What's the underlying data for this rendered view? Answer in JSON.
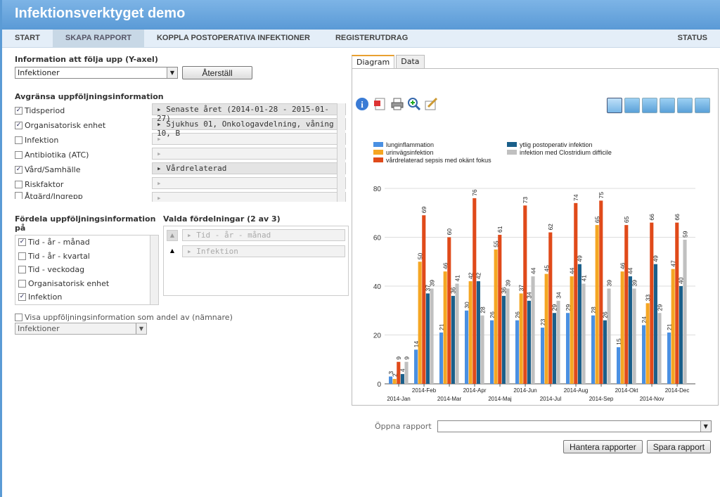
{
  "app": {
    "title": "Infektionsverktyget demo"
  },
  "nav": {
    "items": [
      "START",
      "SKAPA RAPPORT",
      "KOPPLA POSTOPERATIVA INFEKTIONER",
      "REGISTERUTDRAG"
    ],
    "status": "STATUS"
  },
  "yaxis": {
    "label": "Information att följa upp (Y-axel)",
    "value": "Infektioner",
    "reset": "Återställ"
  },
  "limit": {
    "label": "Avgränsa uppföljningsinformation",
    "items": [
      {
        "label": "Tidsperiod",
        "checked": true,
        "value": "Senaste året (2014-01-28 - 2015-01-27)"
      },
      {
        "label": "Organisatorisk enhet",
        "checked": true,
        "value": "Sjukhus 01, Onkologavdelning, våning 10, B"
      },
      {
        "label": "Infektion",
        "checked": false,
        "value": ""
      },
      {
        "label": "Antibiotika (ATC)",
        "checked": false,
        "value": ""
      },
      {
        "label": "Vård/Samhälle",
        "checked": true,
        "value": "Vårdrelaterad"
      },
      {
        "label": "Riskfaktor",
        "checked": false,
        "value": ""
      },
      {
        "label": "Åtgärd/Ingrepp",
        "checked": false,
        "value": ""
      }
    ]
  },
  "distribute": {
    "label": "Fördela uppföljningsinformation på",
    "items": [
      {
        "label": "Tid - år - månad",
        "checked": true
      },
      {
        "label": "Tid - år - kvartal",
        "checked": false
      },
      {
        "label": "Tid - veckodag",
        "checked": false
      },
      {
        "label": "Organisatorisk enhet",
        "checked": false
      },
      {
        "label": "Infektion",
        "checked": true
      }
    ]
  },
  "chosen": {
    "label": "Valda fördelningar (2 av 3)",
    "items": [
      "Tid - år - månad",
      "Infektion"
    ]
  },
  "share": {
    "label": "Visa uppföljningsinformation som andel av (nämnare)",
    "value": "Infektioner"
  },
  "tabs": [
    "Diagram",
    "Data"
  ],
  "report": {
    "open_label": "Öppna rapport",
    "manage": "Hantera rapporter",
    "save": "Spara rapport"
  },
  "colors": {
    "lung": "#4a90e2",
    "uri": "#f5a623",
    "sep": "#e04a1a",
    "post": "#1a5f8a",
    "clos": "#c0c0c0"
  },
  "chart_data": {
    "type": "bar",
    "categories": [
      "2014-Jan",
      "2014-Feb",
      "2014-Mar",
      "2014-Apr",
      "2014-Maj",
      "2014-Jun",
      "2014-Jul",
      "2014-Aug",
      "2014-Sep",
      "2014-Okt",
      "2014-Nov",
      "2014-Dec"
    ],
    "series": [
      {
        "name": "lunginflammation",
        "color": "#4a90e2",
        "values": [
          3,
          14,
          21,
          30,
          26,
          26,
          23,
          29,
          28,
          15,
          24,
          21
        ]
      },
      {
        "name": "urinvägsinfektion",
        "color": "#f5a623",
        "values": [
          2,
          50,
          46,
          42,
          55,
          37,
          45,
          44,
          65,
          46,
          33,
          47
        ]
      },
      {
        "name": "vårdrelaterad sepsis med okänt fokus",
        "color": "#e04a1a",
        "values": [
          9,
          69,
          60,
          76,
          61,
          73,
          62,
          74,
          75,
          65,
          66,
          66
        ]
      },
      {
        "name": "ytlig postoperativ infektion",
        "color": "#1a5f8a",
        "values": [
          4,
          37,
          36,
          42,
          36,
          34,
          29,
          49,
          26,
          44,
          49,
          40
        ]
      },
      {
        "name": "infektion med Clostridium difficile",
        "color": "#c0c0c0",
        "values": [
          9,
          39,
          41,
          28,
          39,
          44,
          34,
          41,
          39,
          39,
          29,
          59
        ]
      }
    ],
    "ylim": [
      0,
      80
    ],
    "yticks": [
      0,
      20,
      40,
      60,
      80
    ],
    "grid": true,
    "legend": "top"
  }
}
